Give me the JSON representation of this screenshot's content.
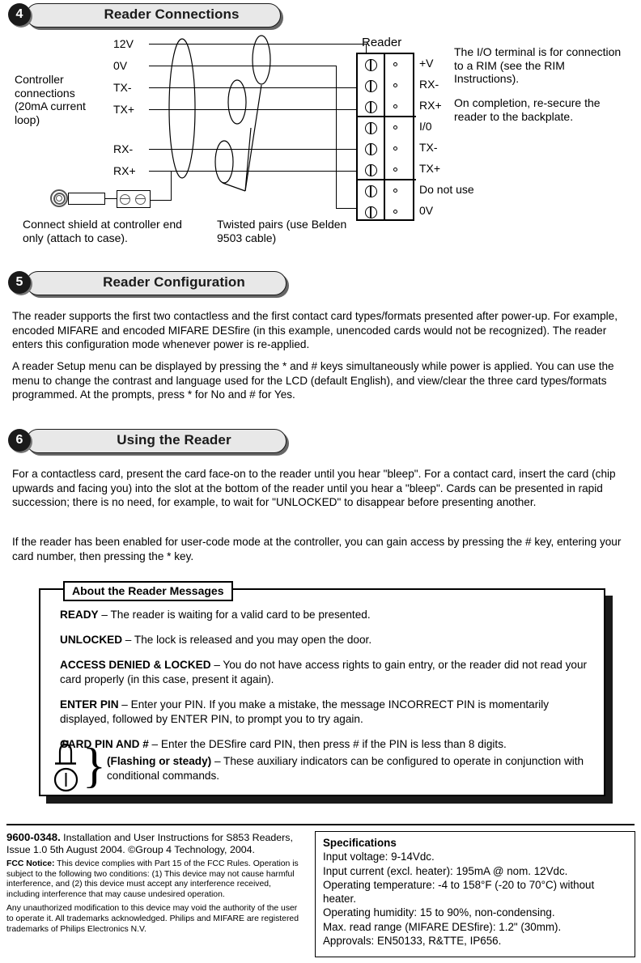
{
  "sections": {
    "four": {
      "number": "4",
      "title": "Reader Connections"
    },
    "five": {
      "number": "5",
      "title": "Reader Configuration"
    },
    "six": {
      "number": "6",
      "title": "Using the Reader"
    }
  },
  "diagram": {
    "controller_label": "Controller connections (20mA current loop)",
    "reader_label": "Reader",
    "wire_labels": [
      "12V",
      "0V",
      "TX-",
      "TX+",
      "RX-",
      "RX+"
    ],
    "shield_note": "Connect shield at controller end only (attach to case).",
    "twisted_note": "Twisted pairs (use Belden 9503 cable)",
    "terminal_groups": [
      {
        "terminals": [
          "+V",
          "RX-",
          "RX+"
        ]
      },
      {
        "terminals": [
          "I/0",
          "TX-",
          "TX+"
        ]
      },
      {
        "terminals": [
          "Do not use",
          "0V"
        ]
      }
    ],
    "note_io": "The I/O terminal is for connection to a RIM (see the RIM Instructions).",
    "note_complete": "On completion, re-secure the reader to the backplate."
  },
  "config": {
    "p1": "The reader supports the first two contactless and the first contact card types/formats presented after power-up. For example, encoded MIFARE and encoded MIFARE DESfire (in this example, unencoded cards would not be recognized). The reader enters this configuration mode whenever power is re-applied.",
    "p2": "A reader Setup menu can be displayed by pressing the * and # keys simultaneously while power is applied. You can use the menu to change the contrast and language used for the LCD (default English), and view/clear the three card types/formats programmed. At the prompts, press * for No and # for Yes."
  },
  "using": {
    "p1": "For a contactless card, present the card face-on to the reader until you hear \"bleep\". For a contact card, insert the card (chip upwards and facing you) into the slot at the bottom of the reader until you hear a \"bleep\". Cards can be presented in rapid succession; there is no need, for example, to wait for \"UNLOCKED\" to disappear before presenting another.",
    "p2": "If the reader has been enabled for user-code mode at the controller, you can gain access by pressing the # key, entering your card number, then pressing the * key."
  },
  "about": {
    "title": "About the Reader Messages",
    "messages": [
      {
        "term": "READY",
        "text": " – The reader is waiting for a valid card to be presented."
      },
      {
        "term": "UNLOCKED",
        "text": " – The lock is released and you may open the door."
      },
      {
        "term": "ACCESS DENIED & LOCKED",
        "text": " – You do not have access rights to gain entry, or the reader did not read your card properly (in this case, present it again)."
      },
      {
        "term": "ENTER PIN",
        "text": " – Enter your PIN. If you make a mistake, the message INCORRECT PIN is momentarily displayed, followed by ENTER PIN, to prompt you to try again."
      },
      {
        "term": "CARD PIN AND #",
        "text": " – Enter the DESfire card PIN, then press # if the PIN is less than 8 digits."
      },
      {
        "term": "(Flashing or steady)",
        "text": " – These auxiliary indicators can be configured to operate in conjunction with conditional commands."
      }
    ]
  },
  "footer": {
    "doc_code": "9600-0348.",
    "doc_line": " Installation and User Instructions for S853 Readers, Issue 1.0 5th August 2004.  ©Group 4 Technology, 2004.",
    "fcc_label": "FCC Notice:",
    "fcc_text": " This device complies with Part 15 of the FCC Rules. Operation is subject to the following two conditions: (1) This device may not cause harmful interference, and (2) this device must accept any interference received, including interference that may cause undesired operation.",
    "trademark_text": "Any unauthorized modification to this device may void the authority of the user to operate it. All trademarks acknowledged. Philips and MIFARE are registered trademarks of Philips Electronics N.V."
  },
  "specifications": {
    "heading": "Specifications",
    "lines": [
      "Input voltage: 9-14Vdc.",
      "Input current (excl. heater): 195mA @ nom. 12Vdc.",
      "Operating temperature: -4 to 158°F (-20 to 70°C) without heater.",
      "Operating humidity: 15 to 90%, non-condensing.",
      "Max. read range (MIFARE DESfire): 1.2\" (30mm).",
      "Approvals: EN50133, R&TTE, IP656."
    ]
  }
}
